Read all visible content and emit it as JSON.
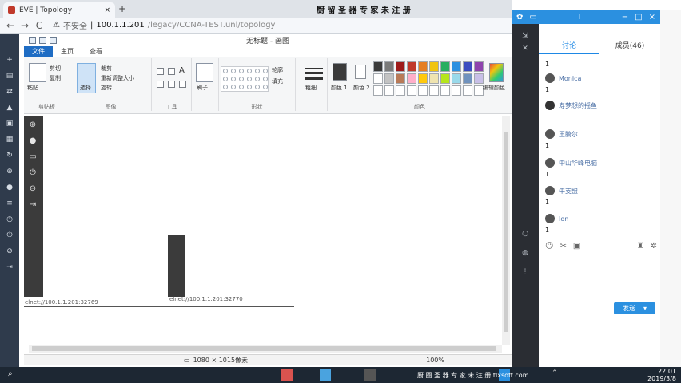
{
  "browser": {
    "tab_title": "EVE | Topology",
    "new_tab": "+",
    "banner": "厨 留 圣 器 专 家  未 注 册",
    "insecure_label": "不安全",
    "url_host": "100.1.1.201",
    "url_path": "/legacy/CCNA-TEST.unl/topology",
    "nav_back": "←",
    "nav_forward": "→",
    "nav_reload": "C"
  },
  "paint": {
    "title": "无标题 - 画图",
    "tabs": [
      "文件",
      "主页",
      "查看"
    ],
    "groups": {
      "clipboard": {
        "label": "剪贴板",
        "paste": "粘贴",
        "cut": "剪切",
        "copy": "复制"
      },
      "image": {
        "label": "图像",
        "select": "选择",
        "crop": "裁剪",
        "resize": "重新调整大小",
        "rotate": "旋转"
      },
      "tools": {
        "label": "工具"
      },
      "brushes": {
        "label": "刷子"
      },
      "shapes": {
        "label": "形状",
        "outline": "轮廓",
        "fill": "填充"
      },
      "size": {
        "label": "粗细"
      },
      "colors": {
        "label": "颜色",
        "color1": "颜色 1",
        "color2": "颜色 2",
        "edit": "编辑颜色"
      }
    },
    "consoles": [
      {
        "label": "elnet://100.1.1.201:32769"
      },
      {
        "label": "elnet://100.1.1.201:32770"
      }
    ],
    "status": {
      "dimensions": "1080 × 1015像素",
      "zoom": "100%"
    },
    "swatch_colors": [
      "#3a3a3a",
      "#7a7a7a",
      "#9e1b1b",
      "#c0392b",
      "#e67e22",
      "#f1c40f",
      "#27ae60",
      "#2b90e0",
      "#3b4cc0",
      "#8e44ad",
      "#ffffff",
      "#c3c3c3",
      "#b97a57",
      "#ffaec9",
      "#ffc90e",
      "#efe4b0",
      "#b5e61d",
      "#99d9ea",
      "#7092be",
      "#c8bfe7",
      "#ffffff",
      "#ffffff",
      "#ffffff",
      "#ffffff",
      "#ffffff",
      "#ffffff",
      "#ffffff",
      "#ffffff",
      "#ffffff",
      "#ffffff"
    ]
  },
  "chat": {
    "tabs": {
      "discuss": "讨论",
      "members": "成员(46)"
    },
    "entries": [
      {
        "name": "",
        "msg": "1"
      },
      {
        "name": "Monica",
        "msg": "1"
      },
      {
        "name": "寿梦想的摇鱼",
        "msg": ""
      },
      {
        "name": "王鹏尔",
        "msg": "1"
      },
      {
        "name": "中山华峰电脑",
        "msg": "1"
      },
      {
        "name": "牛支盟",
        "msg": "1"
      },
      {
        "name": "Ion",
        "msg": "1"
      }
    ],
    "send_label": "发送",
    "send_dropdown": "▾"
  },
  "taskbar": {
    "caption": "厨 圈 圣 器 专 家 未 注 册 tlxsoft.com",
    "time": "22:01",
    "date": "2019/3/8"
  }
}
